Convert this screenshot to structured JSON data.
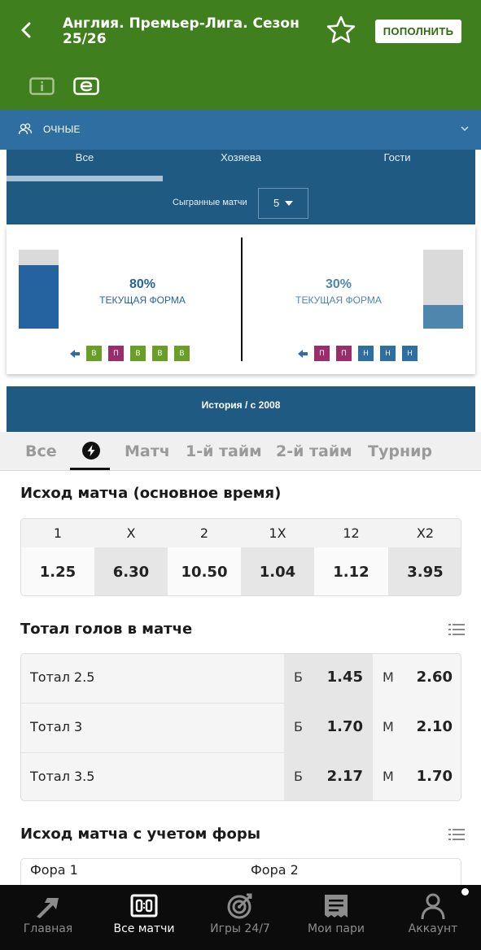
{
  "header": {
    "title": "Англия. Премьер-Лига. Сезон 25/26",
    "topup_label": "ПОПОЛНИТЬ",
    "icons": [
      "back-icon",
      "star-icon",
      "info-icon",
      "e-icon"
    ]
  },
  "filter": {
    "label": "ОЧНЫЕ",
    "icons": [
      "people-icon",
      "chevron-down-icon"
    ]
  },
  "stats": {
    "tabs": [
      "Все",
      "Хозяева",
      "Гости"
    ],
    "active_tab": "Все",
    "played_label": "Сыгранные матчи",
    "played_value": "5",
    "home": {
      "percent_label": "80%",
      "percent": 80,
      "caption": "ТЕКУЩАЯ ФОРМА",
      "results": [
        "В",
        "П",
        "В",
        "В",
        "В"
      ]
    },
    "away": {
      "percent_label": "30%",
      "percent": 30,
      "caption": "ТЕКУЩАЯ ФОРМА",
      "results": [
        "П",
        "П",
        "Н",
        "Н",
        "Н"
      ]
    },
    "history_label": "История / с 2008",
    "colors": {
      "win": "#6a9f27",
      "loss": "#9c2d6c",
      "draw": "#2e6ea1",
      "home_bar": "#2463a0",
      "away_bar": "#4f86ad"
    }
  },
  "market_tabs": {
    "items": [
      "Все",
      "Матч",
      "1-й тайм",
      "2-й тайм",
      "Турнир"
    ],
    "active_icon": "lightning-icon"
  },
  "outcome": {
    "title": "Исход матча (основное время)",
    "headers": [
      "1",
      "X",
      "2",
      "1X",
      "12",
      "X2"
    ],
    "odds": [
      "1.25",
      "6.30",
      "10.50",
      "1.04",
      "1.12",
      "3.95"
    ]
  },
  "totals": {
    "title": "Тотал голов в матче",
    "rows": [
      {
        "name": "Тотал 2.5",
        "over_label": "Б",
        "over": "1.45",
        "under_label": "М",
        "under": "2.60"
      },
      {
        "name": "Тотал 3",
        "over_label": "Б",
        "over": "1.70",
        "under_label": "М",
        "under": "2.10"
      },
      {
        "name": "Тотал 3.5",
        "over_label": "Б",
        "over": "2.17",
        "under_label": "М",
        "under": "1.70"
      }
    ]
  },
  "handicap": {
    "title": "Исход матча с учетом форы",
    "col1": "Фора 1",
    "col2": "Фора 2"
  },
  "nav": {
    "items": [
      {
        "label": "Главная",
        "icon": "home-arrow-icon"
      },
      {
        "label": "Все матчи",
        "icon": "scoreboard-icon"
      },
      {
        "label": "Игры 24/7",
        "icon": "target-icon"
      },
      {
        "label": "Мои пари",
        "icon": "ticket-icon"
      },
      {
        "label": "Аккаунт",
        "icon": "user-icon"
      }
    ],
    "active": "Все матчи"
  }
}
